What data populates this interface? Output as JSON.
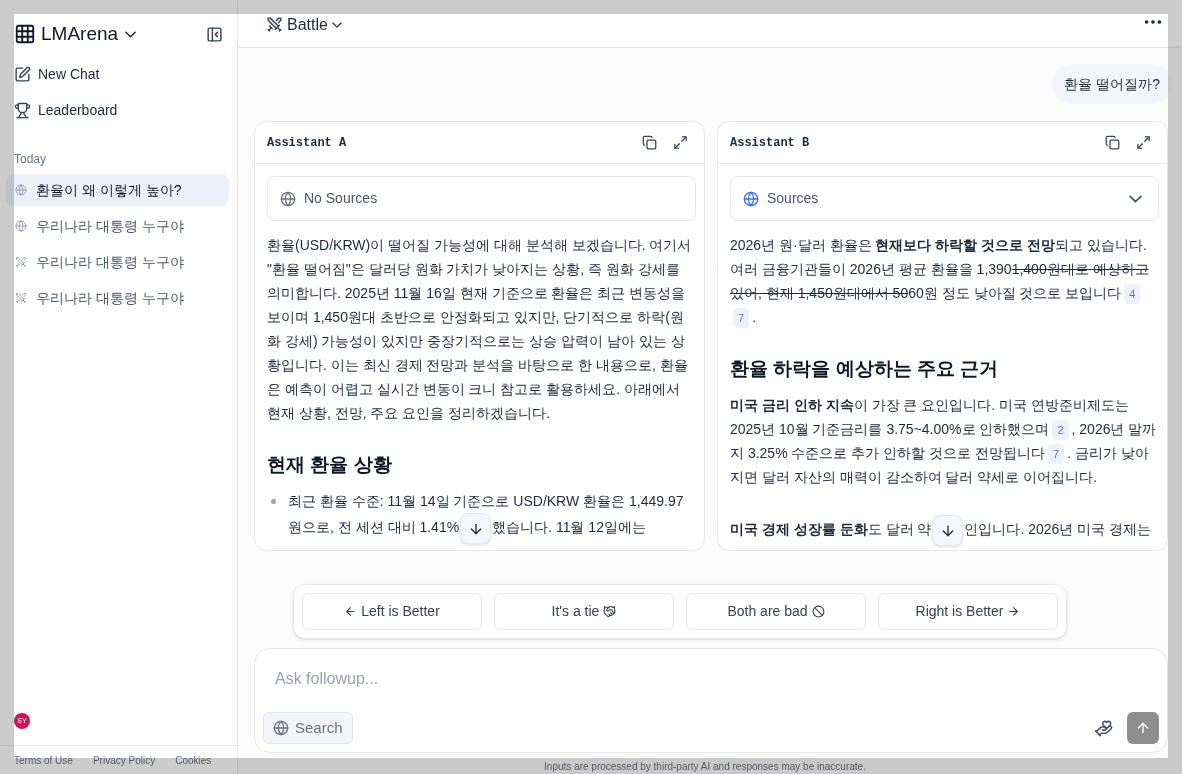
{
  "sidebar": {
    "brand": "LMArena",
    "nav": [
      {
        "kind": "new",
        "label": "New Chat"
      },
      {
        "kind": "leaderboard",
        "label": "Leaderboard"
      }
    ],
    "section": "Today",
    "history": [
      {
        "kind": "search",
        "label": "환율이 왜 이렇게 높아?",
        "selected": true
      },
      {
        "kind": "search",
        "label": "우리나라 대통령 누구야",
        "selected": false
      },
      {
        "kind": "battle",
        "label": "우리나라 대통령 누구야",
        "selected": false
      },
      {
        "kind": "battle",
        "label": "우리나라 대통령 누구야",
        "selected": false
      }
    ],
    "avatar": "SY",
    "footer_links": [
      "Terms of Use",
      "Privacy Policy",
      "Cookies"
    ]
  },
  "header": {
    "mode": "Battle"
  },
  "user_message": "환율 떨어질까?",
  "assistants": [
    {
      "title": "Assistant A",
      "sources": {
        "label": "No Sources",
        "available": false
      },
      "blocks": [
        {
          "kind": "paragraph",
          "segments": [
            {
              "kind": "text",
              "text": "환율(USD/KRW)이 떨어질 가능성에 대해 분석해 보겠습니다. 여기서 \"환율 떨어짐\"은 달러당 원화 가치가 낮아지는 상황, 즉 원화 강세를 의미합니다. 2025년 11월 16일 현재 기준으로 환율은 최근 변동성을 보이며 1,450원대 초반으로 안정화되고 있지만, 단기적으로 하락(원화 강세) 가능성이 있지만 중장기적으로는 상승 압력이 남아 있는 상황입니다. 이는 최신 경제 전망과 분석을 바탕으로 한 내용으로, 환율은 예측이 어렵고 실시간 변동이 크니 참고로 활용하세요. 아래에서 현재 상황, 전망, 주요 요인을 정리하겠습니다."
            }
          ]
        },
        {
          "kind": "heading",
          "text": "현재 환율 상황"
        },
        {
          "kind": "bullet",
          "segments": [
            {
              "kind": "text",
              "text": "최근 환율 수준: 11월 14일 기준으로 USD/KRW 환율은 1,449.97원으로, 전 세션 대비 1.41%"
            },
            {
              "kind": "hidden"
            },
            {
              "kind": "text",
              "text": "했습니다. 11월 12일에는"
            }
          ]
        }
      ]
    },
    {
      "title": "Assistant B",
      "sources": {
        "label": "Sources",
        "available": true
      },
      "blocks": [
        {
          "kind": "paragraph",
          "segments": [
            {
              "kind": "text",
              "text": "2026년 원·달러 환율은 **현재보다 하락할 것으로 전망**되고 있습니다. 여러 금융기관들이 2026년 평균 환율을 1,390"
            },
            {
              "kind": "strike",
              "text": "1,400원대로 예상하고 있어, 현재 1,450원대에서 50"
            },
            {
              "kind": "text",
              "text": "60원 정도 낮아질 것으로 보입니다"
            },
            {
              "kind": "cite",
              "text": "4"
            },
            {
              "kind": "cite",
              "text": "7"
            },
            {
              "kind": "text",
              "text": "."
            }
          ]
        },
        {
          "kind": "heading",
          "text": "환율 하락을 예상하는 주요 근거"
        },
        {
          "kind": "paragraph",
          "segments": [
            {
              "kind": "text",
              "text": "**미국 금리 인하 지속**이 가장 큰 요인입니다. 미국 연방준비제도는 2025년 10월 기준금리를 3.75~4.00%로 인하했으며"
            },
            {
              "kind": "cite",
              "text": "2"
            },
            {
              "kind": "text",
              "text": ", 2026년 말까지 3.25% 수준으로 추가 인하할 것으로 전망됩니다"
            },
            {
              "kind": "cite",
              "text": "7"
            },
            {
              "kind": "text",
              "text": ". 금리가 낮아지면 달러 자산의 매력이 감소하여 달러 약세로 이어집니다."
            }
          ]
        },
        {
          "kind": "paragraph",
          "segments": [
            {
              "kind": "text",
              "text": "**미국 경제 성장률 둔화**도 달러 약"
            },
            {
              "kind": "hidden"
            },
            {
              "kind": "text",
              "text": "인입니다. 2026년 미국 경제는"
            }
          ]
        }
      ]
    }
  ],
  "votes": [
    {
      "kind": "left",
      "label": "Left is Better"
    },
    {
      "kind": "tie",
      "label": "It's a tie"
    },
    {
      "kind": "bad",
      "label": "Both are bad"
    },
    {
      "kind": "right",
      "label": "Right is Better"
    }
  ],
  "composer": {
    "placeholder": "Ask followup...",
    "search": "Search"
  },
  "disclaimer": "Inputs are processed by third-party AI and responses may be inaccurate."
}
